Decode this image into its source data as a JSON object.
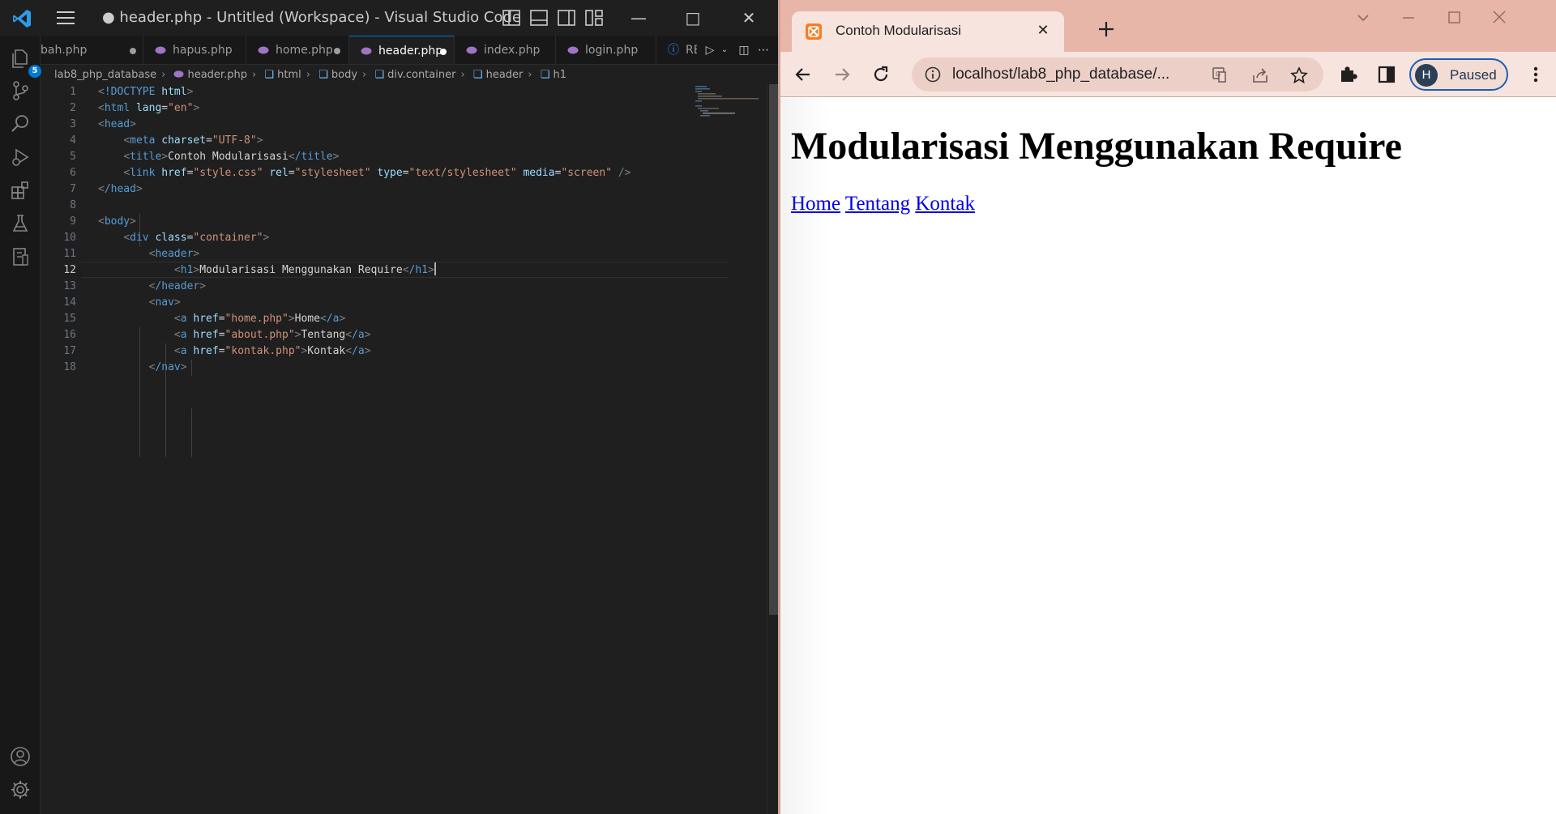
{
  "vscode": {
    "title": "● header.php - Untitled (Workspace) - Visual Studio Code",
    "explorer_badge": "5",
    "tabs": [
      {
        "label": "bah.php",
        "dirty": true
      },
      {
        "label": "hapus.php",
        "dirty": false
      },
      {
        "label": "home.php",
        "dirty": true
      },
      {
        "label": "header.php",
        "dirty": true,
        "active": true
      },
      {
        "label": "index.php",
        "dirty": false
      },
      {
        "label": "login.php",
        "dirty": false
      },
      {
        "label": "READMEA",
        "dirty": false
      }
    ],
    "breadcrumb": [
      "lab8_php_database",
      "header.php",
      "html",
      "body",
      "div.container",
      "header",
      "h1"
    ],
    "line_numbers": [
      "1",
      "2",
      "3",
      "4",
      "5",
      "6",
      "7",
      "8",
      "9",
      "10",
      "11",
      "12",
      "13",
      "14",
      "15",
      "16",
      "17",
      "18"
    ],
    "current_line": "12",
    "code": {
      "l1_doctype": "!DOCTYPE",
      "l1_html": "html",
      "l2_tag": "html",
      "l2_attr": "lang",
      "l2_val": "\"en\"",
      "l3_tag": "head",
      "l4_tag": "meta",
      "l4_attr": "charset",
      "l4_val": "\"UTF-8\"",
      "l5_tag": "title",
      "l5_text": "Contoh Modularisasi",
      "l5_close": "/title",
      "l6_tag": "link",
      "l6_a1": "href",
      "l6_v1": "\"style.css\"",
      "l6_a2": "rel",
      "l6_v2": "\"stylesheet\"",
      "l6_a3": "type",
      "l6_v3": "\"text/stylesheet\"",
      "l6_a4": "media",
      "l6_v4": "\"screen\"",
      "l7_tag": "/head",
      "l9_tag": "body",
      "l10_tag": "div",
      "l10_attr": "class",
      "l10_val": "\"container\"",
      "l11_tag": "header",
      "l12_tag": "h1",
      "l12_text": "Modularisasi Menggunakan Require",
      "l12_close": "/h1",
      "l13_tag": "/header",
      "l14_tag": "nav",
      "l15_tag": "a",
      "l15_attr": "href",
      "l15_val": "\"home.php\"",
      "l15_text": "Home",
      "l15_close": "/a",
      "l16_tag": "a",
      "l16_attr": "href",
      "l16_val": "\"about.php\"",
      "l16_text": "Tentang",
      "l16_close": "/a",
      "l17_tag": "a",
      "l17_attr": "href",
      "l17_val": "\"kontak.php\"",
      "l17_text": "Kontak",
      "l17_close": "/a",
      "l18_tag": "/nav"
    }
  },
  "browser": {
    "tab_title": "Contoh Modularisasi",
    "url": "localhost/lab8_php_database/...",
    "profile_initial": "H",
    "profile_label": "Paused",
    "page": {
      "heading": "Modularisasi Menggunakan Require",
      "nav_links": [
        "Home",
        "Tentang",
        "Kontak"
      ]
    }
  },
  "colors": {
    "vscode_bg": "#1f1f1f",
    "accent": "#0078d4",
    "chrome_tab_strip": "#e8b5a9",
    "link": "#0000ee"
  }
}
